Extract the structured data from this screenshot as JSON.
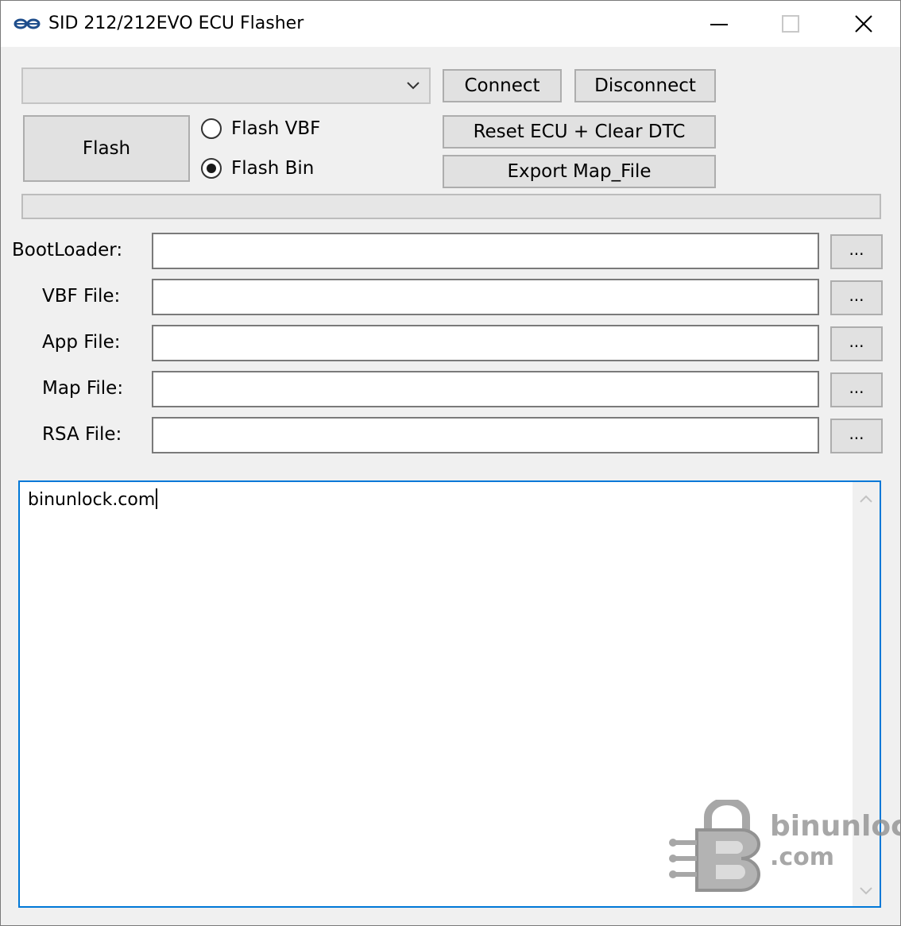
{
  "window": {
    "title": "SID 212/212EVO ECU Flasher"
  },
  "toolbar": {
    "port_select_value": "",
    "connect_label": "Connect",
    "disconnect_label": "Disconnect",
    "flash_label": "Flash",
    "reset_label": "Reset ECU + Clear DTC",
    "export_label": "Export Map_File"
  },
  "flash_mode": {
    "options": [
      {
        "label": "Flash VBF",
        "selected": false
      },
      {
        "label": "Flash Bin",
        "selected": true
      }
    ]
  },
  "progress": {
    "value": 0
  },
  "files": {
    "bootloader_label": "BootLoader:",
    "vbf_label": "VBF File:",
    "app_label": "App File:",
    "map_label": "Map File:",
    "rsa_label": "RSA File:",
    "bootloader_value": "",
    "vbf_value": "",
    "app_value": "",
    "map_value": "",
    "rsa_value": "",
    "browse_label": "..."
  },
  "log": {
    "text": "binunlock.com"
  },
  "watermark": {
    "line1": "binunlock",
    "line2": ".com"
  },
  "icons": {
    "app": "app-logo-icon",
    "minimize": "minimize-icon",
    "maximize": "maximize-icon",
    "close": "close-icon",
    "dropdown": "chevron-down-icon"
  }
}
